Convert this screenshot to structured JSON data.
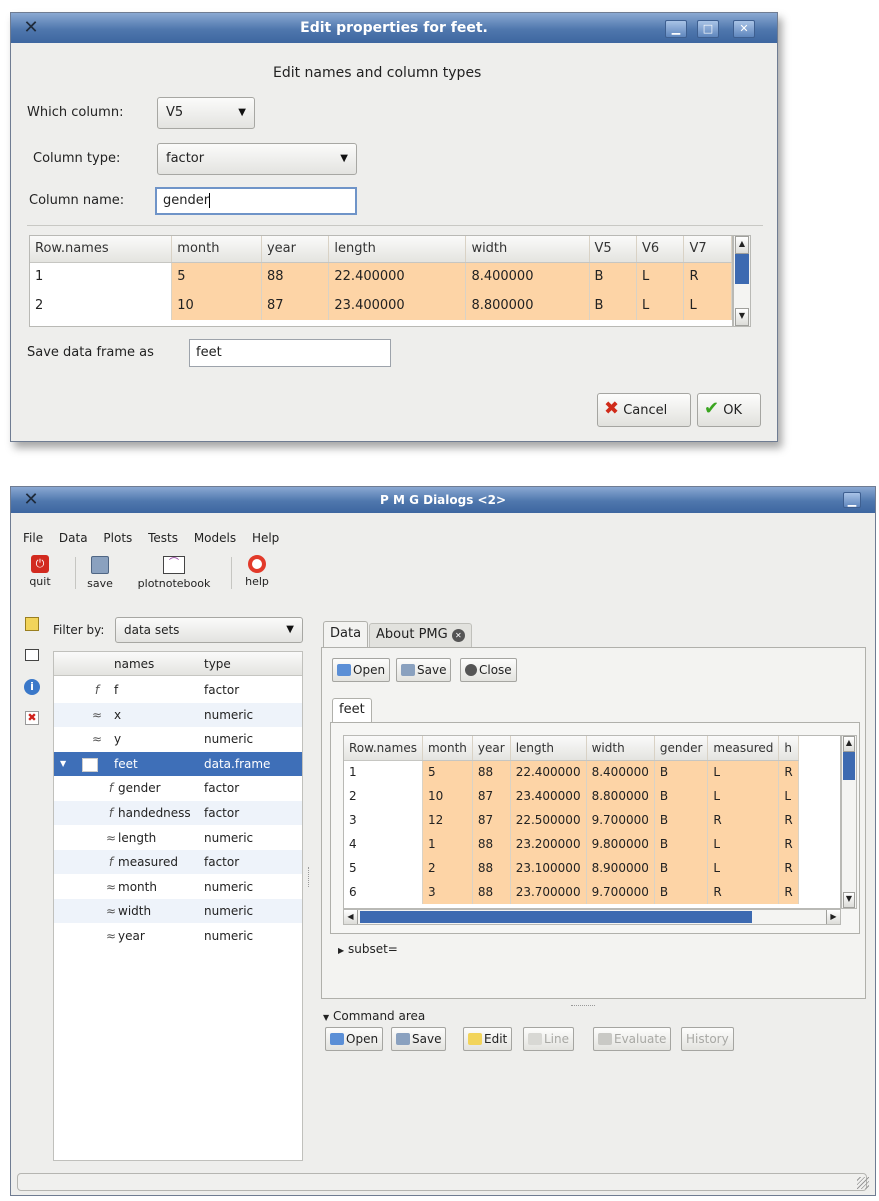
{
  "dialog": {
    "title": "Edit properties for feet.",
    "heading": "Edit names and column types",
    "which_column_label": "Which column:",
    "which_column_value": "V5",
    "column_type_label": "Column type:",
    "column_type_value": "factor",
    "column_name_label": "Column name:",
    "column_name_value": "gender",
    "table": {
      "headers": [
        "Row.names",
        "month",
        "year",
        "length",
        "width",
        "V5",
        "V6",
        "V7"
      ],
      "rows": [
        [
          "1",
          "5",
          "88",
          "22.400000",
          "8.400000",
          "B",
          "L",
          "R"
        ],
        [
          "2",
          "10",
          "87",
          "23.400000",
          "8.800000",
          "B",
          "L",
          "L"
        ]
      ]
    },
    "save_as_label": "Save data frame as",
    "save_as_value": "feet",
    "cancel_label": "Cancel",
    "ok_label": "OK"
  },
  "main": {
    "title": "P M G Dialogs <2>",
    "menu": [
      "File",
      "Data",
      "Plots",
      "Tests",
      "Models",
      "Help"
    ],
    "toolbar": [
      {
        "label": "quit",
        "icon": "quit-icon"
      },
      {
        "label": "save",
        "icon": "save-icon"
      },
      {
        "label": "plotnotebook",
        "icon": "plot-icon"
      },
      {
        "label": "help",
        "icon": "help-icon"
      }
    ],
    "filter_label": "Filter by:",
    "filter_value": "data sets",
    "tree": {
      "headers": [
        "names",
        "type"
      ],
      "rows": [
        {
          "glyph": "f",
          "name": "f",
          "type": "factor",
          "indent": 0
        },
        {
          "glyph": "≈",
          "name": "x",
          "type": "numeric",
          "indent": 0
        },
        {
          "glyph": "≈",
          "name": "y",
          "type": "numeric",
          "indent": 0
        },
        {
          "glyph": "",
          "name": "feet",
          "type": "data.frame",
          "indent": 0,
          "selected": true
        },
        {
          "glyph": "f",
          "name": "gender",
          "type": "factor",
          "indent": 1
        },
        {
          "glyph": "f",
          "name": "handedness",
          "type": "factor",
          "indent": 1
        },
        {
          "glyph": "≈",
          "name": "length",
          "type": "numeric",
          "indent": 1
        },
        {
          "glyph": "f",
          "name": "measured",
          "type": "factor",
          "indent": 1
        },
        {
          "glyph": "≈",
          "name": "month",
          "type": "numeric",
          "indent": 1
        },
        {
          "glyph": "≈",
          "name": "width",
          "type": "numeric",
          "indent": 1
        },
        {
          "glyph": "≈",
          "name": "year",
          "type": "numeric",
          "indent": 1
        }
      ]
    },
    "tabs": [
      "Data",
      "About PMG"
    ],
    "data_buttons": [
      "Open",
      "Save",
      "Close"
    ],
    "sheet_tab": "feet",
    "sheet": {
      "headers": [
        "Row.names",
        "month",
        "year",
        "length",
        "width",
        "gender",
        "measured",
        "h"
      ],
      "rows": [
        [
          "1",
          "5",
          "88",
          "22.400000",
          "8.400000",
          "B",
          "L",
          "R"
        ],
        [
          "2",
          "10",
          "87",
          "23.400000",
          "8.800000",
          "B",
          "L",
          "L"
        ],
        [
          "3",
          "12",
          "87",
          "22.500000",
          "9.700000",
          "B",
          "R",
          "R"
        ],
        [
          "4",
          "1",
          "88",
          "23.200000",
          "9.800000",
          "B",
          "L",
          "R"
        ],
        [
          "5",
          "2",
          "88",
          "23.100000",
          "8.900000",
          "B",
          "L",
          "R"
        ],
        [
          "6",
          "3",
          "88",
          "23.700000",
          "9.700000",
          "B",
          "R",
          "R"
        ]
      ]
    },
    "subset_label": "subset=",
    "command_area_label": "Command area",
    "command_buttons": [
      "Open",
      "Save",
      "Edit",
      "Line",
      "Evaluate",
      "History"
    ]
  }
}
